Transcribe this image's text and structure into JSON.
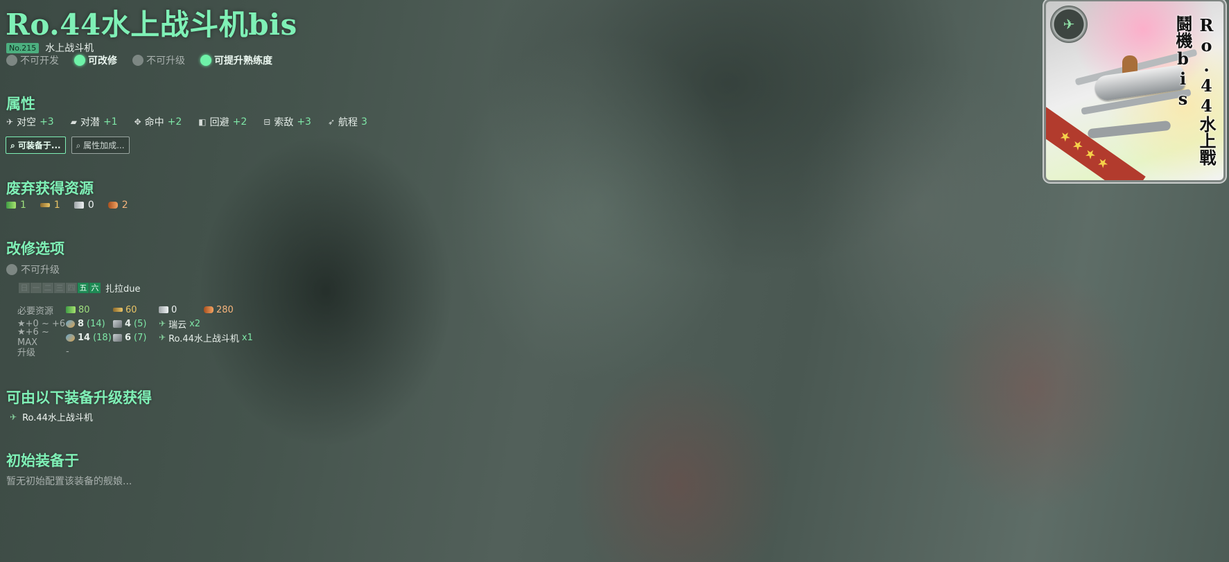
{
  "equipment": {
    "name": "Ro.44水上战斗机bis",
    "no": "No.215",
    "type": "水上战斗机"
  },
  "flags": [
    {
      "label": "不可开发",
      "on": false
    },
    {
      "label": "可改修",
      "on": true
    },
    {
      "label": "不可升级",
      "on": false
    },
    {
      "label": "可提升熟练度",
      "on": true
    }
  ],
  "sections": {
    "stats": "属性",
    "scrap": "废弃获得资源",
    "improvement": "改修选项",
    "upgrade_from": "可由以下装备升级获得",
    "initial": "初始装备于"
  },
  "stats": [
    {
      "label": "对空",
      "value": "+3",
      "icon": "anti-air-icon"
    },
    {
      "label": "对潜",
      "value": "+1",
      "icon": "asw-icon"
    },
    {
      "label": "命中",
      "value": "+2",
      "icon": "accuracy-icon"
    },
    {
      "label": "回避",
      "value": "+2",
      "icon": "evasion-icon"
    },
    {
      "label": "索敌",
      "value": "+3",
      "icon": "los-icon"
    },
    {
      "label": "航程",
      "value": "3",
      "icon": "range-icon"
    }
  ],
  "buttons": {
    "equippable": "可装备于...",
    "bonus": "属性加成..."
  },
  "scrap": {
    "fuel": "1",
    "ammo": "1",
    "steel": "0",
    "bauxite": "2"
  },
  "improvement": {
    "upgrade_flag": "不可升级",
    "days": [
      "日",
      "一",
      "二",
      "三",
      "四",
      "五",
      "六"
    ],
    "days_available": [
      false,
      false,
      false,
      false,
      false,
      true,
      true
    ],
    "ship": "扎拉due",
    "rows": {
      "resources_label": "必要资源",
      "fuel": "80",
      "ammo": "60",
      "steel": "0",
      "bauxite": "280",
      "stage1_label": "★+0 ~ +6",
      "stage1_devmat": "8",
      "stage1_devmat_sure": "(14)",
      "stage1_screw": "4",
      "stage1_screw_sure": "(5)",
      "stage1_item": "瑞云",
      "stage1_item_count": "x2",
      "stage2_label": "★+6 ~ MAX",
      "stage2_devmat": "14",
      "stage2_devmat_sure": "(18)",
      "stage2_screw": "6",
      "stage2_screw_sure": "(7)",
      "stage2_item": "Ro.44水上战斗机",
      "stage2_item_count": "x1",
      "upgrade_label": "升级",
      "upgrade_value": "-"
    }
  },
  "upgrade_from": [
    {
      "name": "Ro.44水上战斗机",
      "icon": "seaplane-fighter-icon"
    }
  ],
  "initial_empty": "暂无初始配置该装备的舰娘...",
  "card": {
    "name": "Ro.44水上戰鬪機bis",
    "stars": 4
  },
  "colors": {
    "accent": "#7ff0b6",
    "positive": "#7ee6a6",
    "day_on": "#1f8a55",
    "ribbon": "#b23b2d"
  }
}
